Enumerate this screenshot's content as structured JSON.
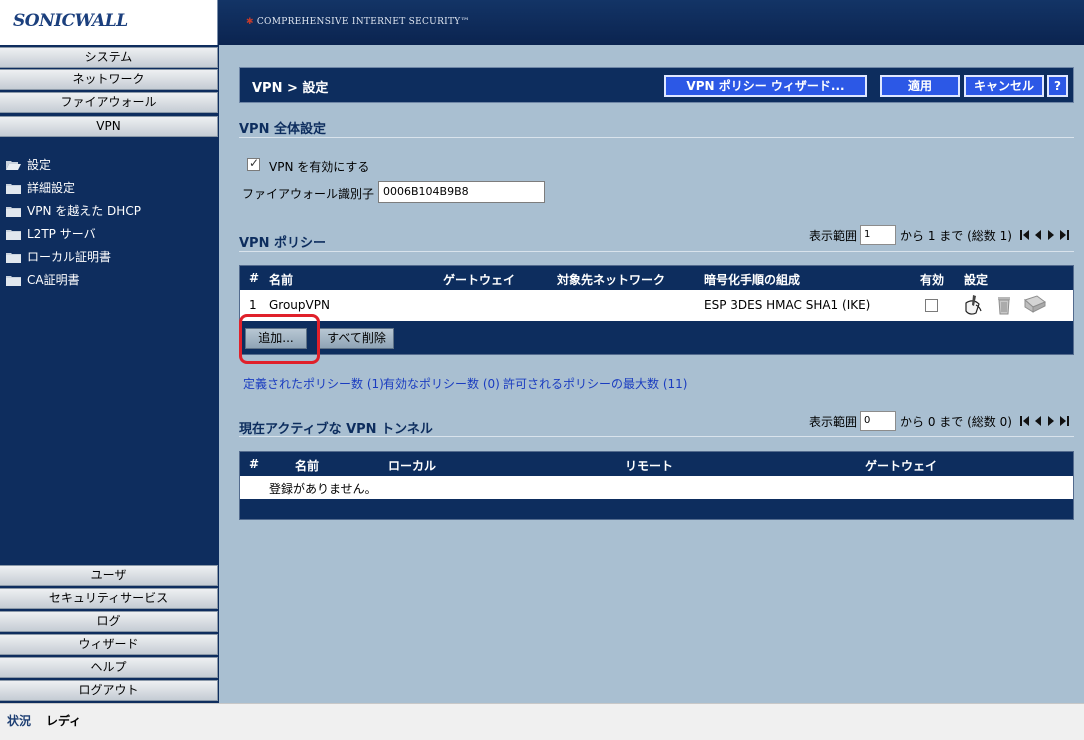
{
  "header": {
    "logo": "SONICWALL",
    "tagline": "COMPREHENSIVE INTERNET SECURITY™"
  },
  "sidebar": {
    "top_items": [
      {
        "label": "システム"
      },
      {
        "label": "ネットワーク"
      },
      {
        "label": "ファイアウォール"
      },
      {
        "label": "VPN"
      }
    ],
    "sub_items": [
      {
        "label": "設定"
      },
      {
        "label": "詳細設定"
      },
      {
        "label": "VPN を越えた DHCP"
      },
      {
        "label": "L2TP サーバ"
      },
      {
        "label": "ローカル証明書"
      },
      {
        "label": "CA証明書"
      }
    ],
    "bottom_items": [
      {
        "label": "ユーザ"
      },
      {
        "label": "セキュリティサービス"
      },
      {
        "label": "ログ"
      },
      {
        "label": "ウィザード"
      },
      {
        "label": "ヘルプ"
      },
      {
        "label": "ログアウト"
      }
    ]
  },
  "titlebar": {
    "title": "VPN > 設定",
    "wizard_button": "VPN ポリシー ウィザード...",
    "apply_button": "適用",
    "cancel_button": "キャンセル",
    "help_button": "?"
  },
  "global_settings": {
    "title": "VPN 全体設定",
    "enable_vpn_label": "VPN を有効にする",
    "enable_vpn_checked": true,
    "firewall_id_label": "ファイアウォール識別子",
    "firewall_id_value": "0006B104B9B8"
  },
  "policies": {
    "title": "VPN ポリシー",
    "pager": {
      "prefix": "表示範囲",
      "value": "1",
      "suffix": "から 1 まで (総数 1)"
    },
    "columns": [
      "#",
      "名前",
      "ゲートウェイ",
      "対象先ネットワーク",
      "暗号化手順の組成",
      "有効",
      "設定"
    ],
    "rows": [
      {
        "num": "1",
        "name": "GroupVPN",
        "gateway": "",
        "destination": "",
        "crypto": "ESP 3DES HMAC SHA1 (IKE)",
        "enabled": false
      }
    ],
    "add_button": "追加...",
    "delete_all_button": "すべて削除",
    "stats": {
      "defined": "定義されたポリシー数 (1)",
      "enabled": "有効なポリシー数 (0)",
      "max": "許可されるポリシーの最大数 (11)"
    }
  },
  "tunnels": {
    "title": "現在アクティブな VPN トンネル",
    "pager": {
      "prefix": "表示範囲",
      "value": "0",
      "suffix": "から 0 まで (総数 0)"
    },
    "columns": [
      "#",
      "名前",
      "ローカル",
      "リモート",
      "ゲートウェイ"
    ],
    "empty_text": "登録がありません。"
  },
  "status": {
    "label": "状況",
    "value": "レディ"
  },
  "colors": {
    "navy": "#0d2d5e",
    "background": "#a9bfd1",
    "button_blue": "#2c58e6",
    "highlight_red": "#e0202a",
    "link_blue": "#1a3cc0"
  }
}
